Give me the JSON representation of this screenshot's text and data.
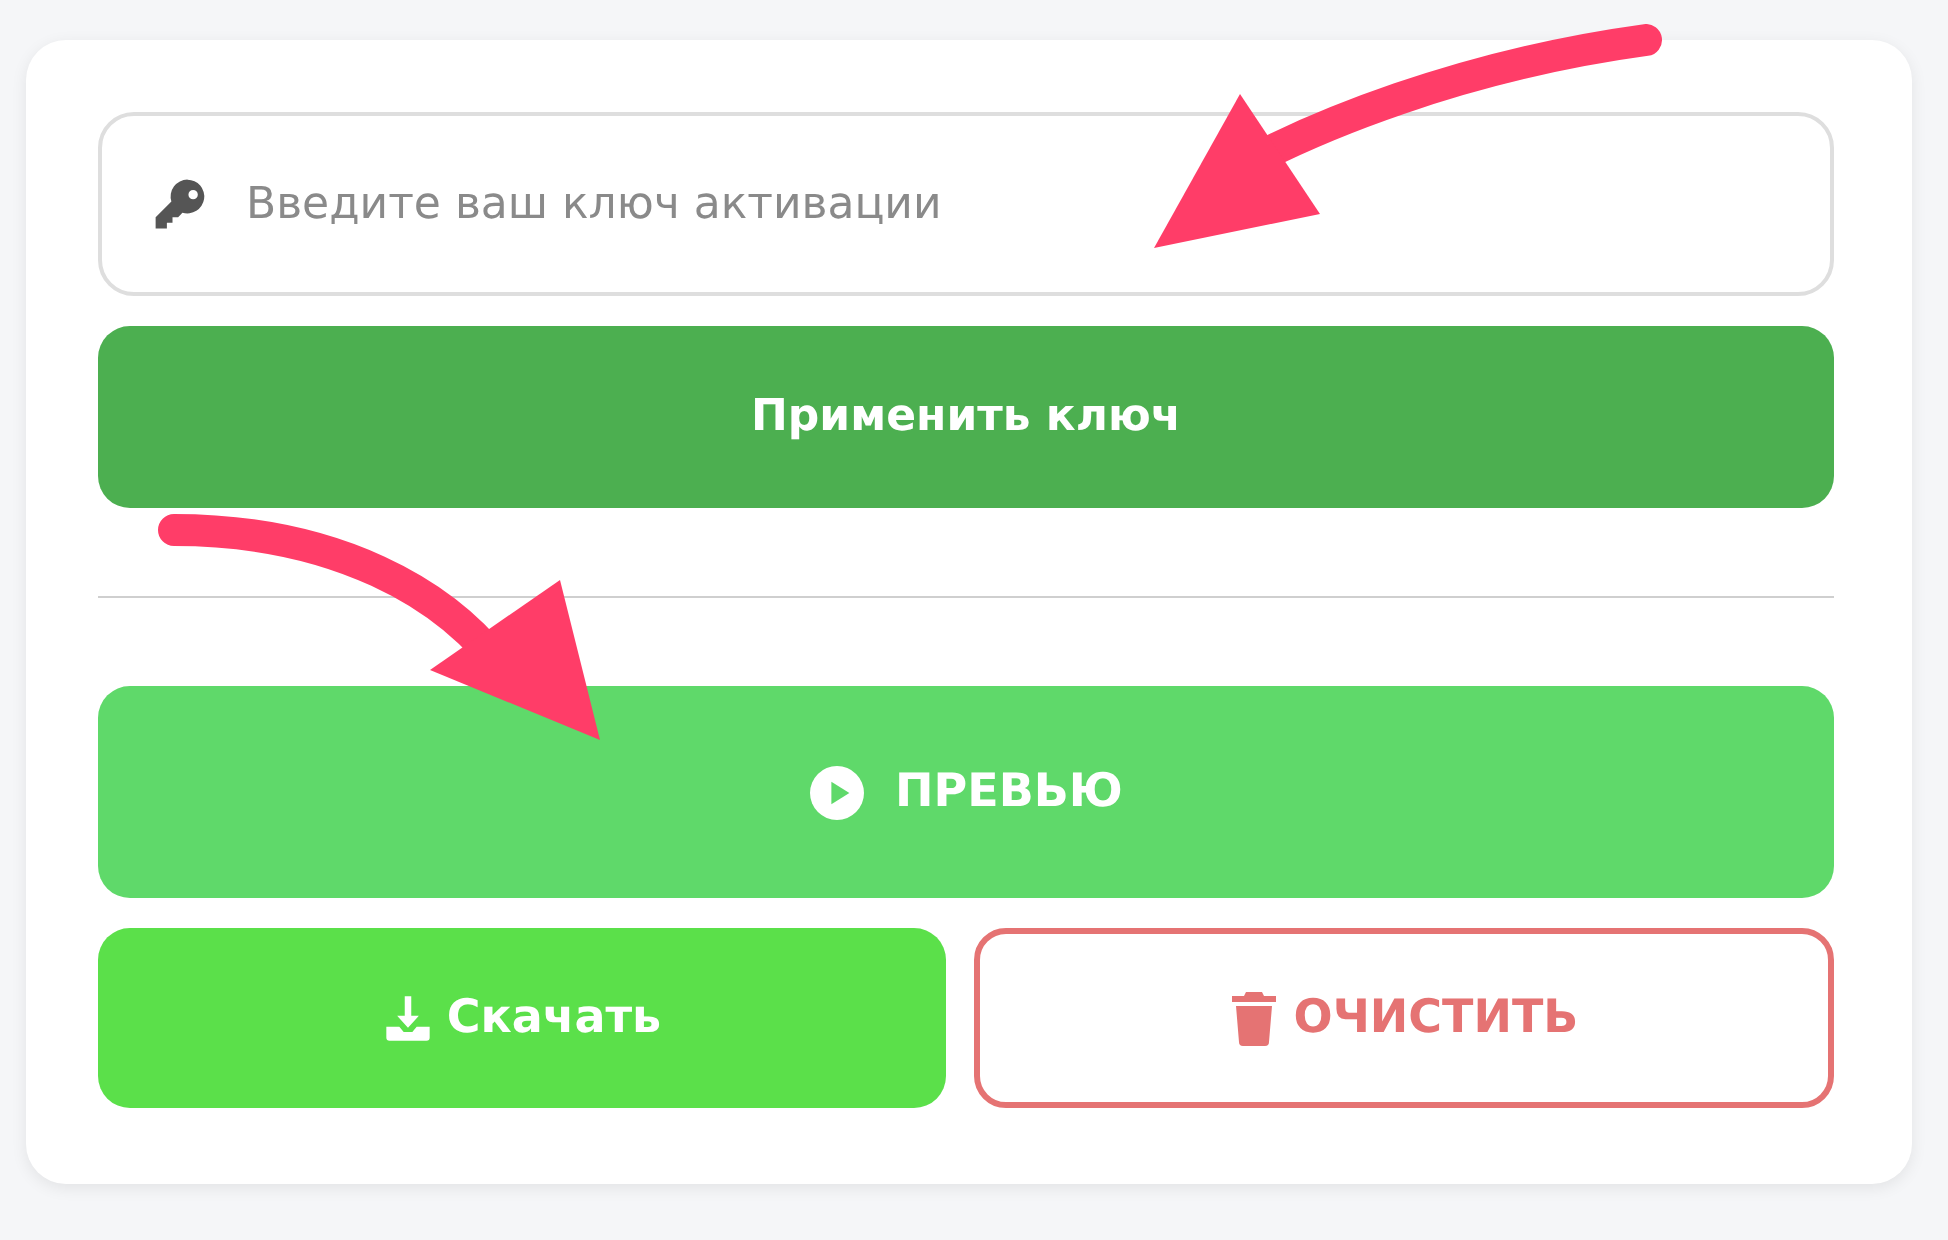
{
  "key_field": {
    "placeholder": "Введите ваш ключ активации"
  },
  "apply_button": {
    "label": "Применить ключ"
  },
  "preview_button": {
    "label": "ПРЕВЬЮ"
  },
  "download_button": {
    "label": "Скачать"
  },
  "clear_button": {
    "label": "ОЧИСТИТЬ"
  }
}
